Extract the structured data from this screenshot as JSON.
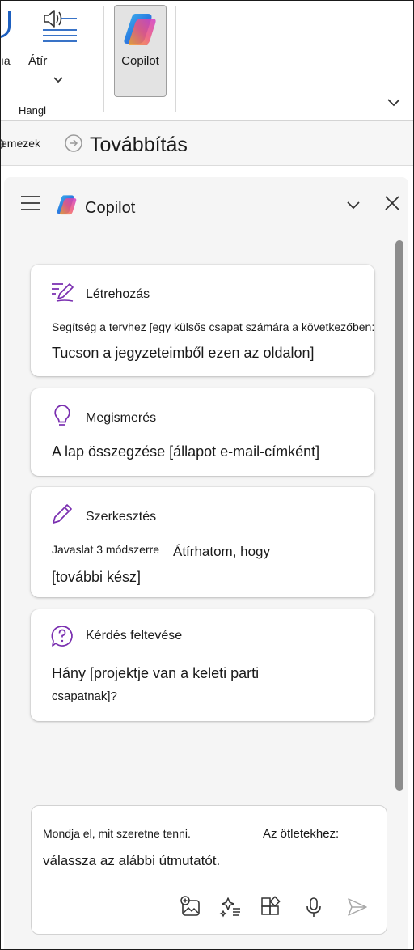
{
  "ribbon": {
    "partial_label": "ıa",
    "read_label": "Átír",
    "group_label": "Hangl",
    "copilot_label": "Copilot"
  },
  "tabbar": {
    "prev_label": "emezek",
    "forward_label": "Továbbítás"
  },
  "pane": {
    "title": "Copilot",
    "cards": [
      {
        "icon": "create-icon",
        "title": "Létrehozás",
        "lines": [
          "Segítség a tervhez [egy külsős csapat számára a következőben:",
          "Tucson a jegyzeteimből ezen az oldalon]"
        ]
      },
      {
        "icon": "lightbulb-icon",
        "title": "Megismerés",
        "lines": [
          "A lap összegzése [állapot e-mail-címként]"
        ]
      },
      {
        "icon": "pencil-icon",
        "title": "Szerkesztés",
        "lines": [
          "Javaslat 3 módszerre",
          "Átírhatom, hogy",
          "[további kész]"
        ]
      },
      {
        "icon": "question-icon",
        "title": "Kérdés feltevése",
        "lines": [
          "Hány [projektje van a keleti parti",
          "csapatnak]?"
        ]
      }
    ],
    "composer": {
      "text1": "Mondja el, mit szeretne tenni.",
      "text2": "Az ötletekhez:",
      "text3": "válassza az alábbi útmutatót."
    }
  },
  "colors": {
    "accent_purple": "#7a2fb0",
    "ribbon_blue": "#1d5fbf",
    "pane_bg": "#f5f5f5"
  }
}
